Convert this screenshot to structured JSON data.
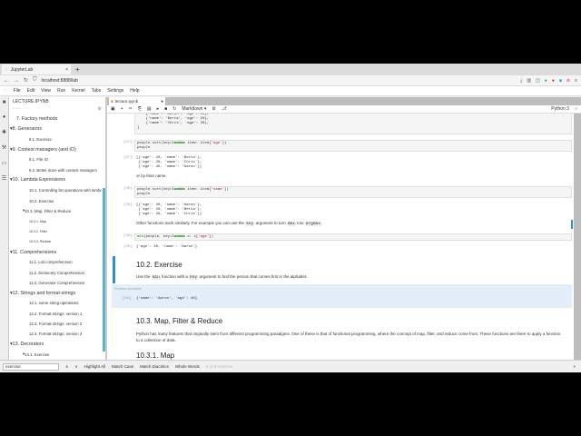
{
  "browser": {
    "tab_title": "JupyterLab",
    "new_tab": "+",
    "close": "×",
    "url": "localhost:8888/lab"
  },
  "menu": [
    "File",
    "Edit",
    "View",
    "Run",
    "Kernel",
    "Tabs",
    "Settings",
    "Help"
  ],
  "panel": {
    "title": "LECTURE.IPYNB",
    "toc": [
      {
        "t": "7. Factory methods",
        "l": 1,
        "c": false
      },
      {
        "t": "8. Generators",
        "l": 1,
        "c": true
      },
      {
        "t": "8.1. Exercise",
        "l": 2
      },
      {
        "t": "9. Context managers (and IO)",
        "l": 1,
        "c": true
      },
      {
        "t": "9.1. File IO",
        "l": 2
      },
      {
        "t": "9.2. Better done with context managers",
        "l": 2
      },
      {
        "t": "10. Lambda Expressions",
        "l": 1,
        "c": true
      },
      {
        "t": "10.1. Controlling list operations with lambdas",
        "l": 2
      },
      {
        "t": "10.2. Exercise",
        "l": 2
      },
      {
        "t": "10.3. Map, Filter & Reduce",
        "l": 2,
        "c": true
      },
      {
        "t": "10.3.1. Map",
        "l": 3
      },
      {
        "t": "10.3.2. Filter",
        "l": 3
      },
      {
        "t": "10.3.3. Reduce",
        "l": 3
      },
      {
        "t": "11. Comprehensions",
        "l": 1,
        "c": true
      },
      {
        "t": "11.1. List comprehension",
        "l": 2
      },
      {
        "t": "11.2. Dictionary Comprehension",
        "l": 2
      },
      {
        "t": "11.3. Generator Comprehension",
        "l": 2
      },
      {
        "t": "12. Strings and format-strings",
        "l": 1,
        "c": true
      },
      {
        "t": "12.1. some string-operations",
        "l": 2
      },
      {
        "t": "12.2. Format-strings: version 1",
        "l": 2
      },
      {
        "t": "12.3. Format-strings: version 2",
        "l": 2
      },
      {
        "t": "12.4. Format-strings: version 3",
        "l": 2
      },
      {
        "t": "13. Decorators",
        "l": 1,
        "c": true
      },
      {
        "t": "13.1. Exercise",
        "l": 2,
        "c": true
      }
    ]
  },
  "notebook": {
    "tab": "lecture.ipynb",
    "cell_type": "Markdown",
    "kernel": "Python 3",
    "cells": {
      "c0_out": "    {'name': 'Aaron', 'age': 40},\n    {'name': 'Berta', 'age': 20},\n    {'name': 'Chris', 'age': 29},\n]",
      "p1": "[37]:",
      "c1_l1a": "people.sort(key=",
      "c1_kw": "lambda",
      "c1_l1b": " item: item[",
      "c1_str": "'age'",
      "c1_l1c": "])\npeople",
      "p1o": "[37]:",
      "c1_out": "[{'age': 20, 'name': 'Berta'},\n {'age': 29, 'name': 'Chris'},\n {'age': 40, 'name': 'Aaron'}]",
      "md1": "or by their name.",
      "p2": "[38]:",
      "c2_a": "people.sort(key=",
      "c2_kw": "lambda",
      "c2_b": " item: item[",
      "c2_str": "'name'",
      "c2_c": "])\npeople",
      "p2o": "[38]:",
      "c2_out": "[{'age': 40, 'name': 'Aaron'},\n {'age': 20, 'name': 'Berta'},\n {'age': 29, 'name': 'Chris'}]",
      "md2a": "Other functions work similarly. For example you can use the ",
      "md2_key": "key",
      "md2b": " argument to turn ",
      "md2_max": "max",
      "md2c": " into ",
      "md2_argmax": "argmax",
      "md2d": ".",
      "p3": "[39]:",
      "c3_fn": "min",
      "c3_a": "(people, key=",
      "c3_kw": "lambda",
      "c3_b": " x: x[",
      "c3_str": "'age'",
      "c3_c": "])",
      "p3o": "[39]:",
      "c3_out": "{'age': 40, 'name': 'Aaron'}",
      "h_ex": "10.2. Exercise",
      "md3a": "Use the ",
      "md3_min": "min",
      "md3b": " function with a ",
      "md3_key": "key",
      "md3c": " argument to find the person that comes first in the alphabet.",
      "sol": "Solution available",
      "p4": "[64]:",
      "c4_out": "{'name': 'Aaron', 'age': 40}",
      "h_map": "10.3. Map, Filter & Reduce",
      "md4": "Python has many features that originally stem from different programming paradigms. One of these is that of functional programming, where the concept of map, filter, and reduce come from. These functions are there to apply a function to a collection of data.",
      "h_next": "10.3.1. Map"
    }
  },
  "find": {
    "value": "exercise",
    "highlight": "Highlight All",
    "match_case": "Match Case",
    "diacritics": "Match Diacritics",
    "whole": "Whole Words",
    "status": "6 of 8 matches"
  }
}
